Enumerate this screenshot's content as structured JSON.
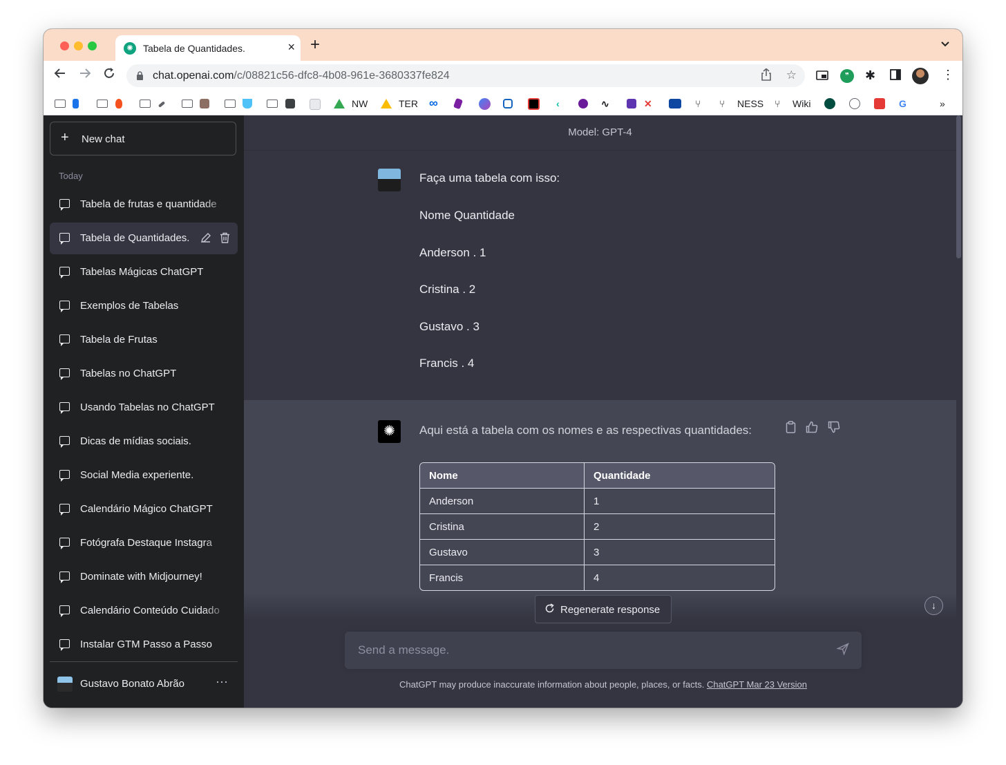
{
  "browser": {
    "tab_title": "Tabela de Quantidades.",
    "tab_close": "×",
    "new_tab": "+",
    "url_host": "chat.openai.com",
    "url_path": "/c/08821c56-dfc8-4b08-961e-3680337fe824",
    "bookmarks": {
      "nw": "NW",
      "ter": "TER",
      "ness": "NESS",
      "wiki": "Wiki",
      "overflow": "»"
    }
  },
  "sidebar": {
    "new_chat": "New chat",
    "section_today": "Today",
    "items": [
      {
        "label": "Tabela de frutas e quantidade"
      },
      {
        "label": "Tabela de Quantidades."
      },
      {
        "label": "Tabelas Mágicas ChatGPT"
      },
      {
        "label": "Exemplos de Tabelas"
      },
      {
        "label": "Tabela de Frutas"
      },
      {
        "label": "Tabelas no ChatGPT"
      },
      {
        "label": "Usando Tabelas no ChatGPT"
      },
      {
        "label": "Dicas de mídias sociais."
      },
      {
        "label": "Social Media experiente."
      },
      {
        "label": "Calendário Mágico ChatGPT"
      },
      {
        "label": "Fotógrafa Destaque Instagra"
      },
      {
        "label": "Dominate with Midjourney!"
      },
      {
        "label": "Calendário Conteúdo Cuidado"
      },
      {
        "label": "Instalar GTM Passo a Passo"
      }
    ],
    "user_name": "Gustavo Bonato Abrão",
    "user_more": "···"
  },
  "main": {
    "model_label": "Model: GPT-4",
    "user_message": [
      "Faça uma tabela com isso:",
      "Nome Quantidade",
      "Anderson . 1",
      "Cristina . 2",
      "Gustavo . 3",
      "Francis . 4"
    ],
    "assistant_intro": "Aqui está a tabela com os nomes e as respectivas quantidades:",
    "table": {
      "headers": [
        "Nome",
        "Quantidade"
      ],
      "rows": [
        [
          "Anderson",
          "1"
        ],
        [
          "Cristina",
          "2"
        ],
        [
          "Gustavo",
          "3"
        ],
        [
          "Francis",
          "4"
        ]
      ]
    },
    "regenerate": "Regenerate response",
    "input_placeholder": "Send a message.",
    "disclaimer": "ChatGPT may produce inaccurate information about people, places, or facts.",
    "version_link": "ChatGPT Mar 23 Version"
  },
  "colors": {
    "sidebar_bg": "#202123",
    "main_bg": "#343541",
    "assistant_bg": "#444654",
    "titlebar_bg": "#fbdcc9",
    "accent": "#10a37f"
  },
  "icons": [
    "back-icon",
    "forward-icon",
    "reload-icon",
    "lock-icon",
    "share-icon",
    "star-icon",
    "extension-icon",
    "chat-bubble-icon",
    "edit-icon",
    "trash-icon",
    "copy-icon",
    "thumbs-up-icon",
    "thumbs-down-icon",
    "refresh-icon",
    "send-icon",
    "arrow-down-icon"
  ]
}
